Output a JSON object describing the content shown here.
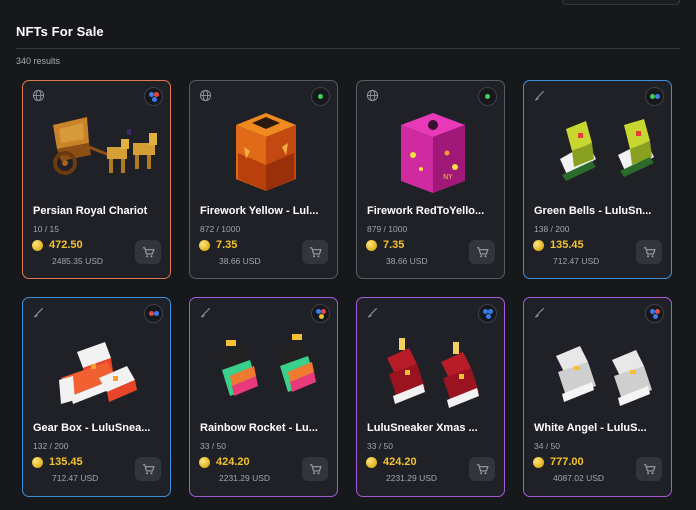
{
  "section": {
    "title": "NFTs For Sale",
    "results": "340 results"
  },
  "cards": [
    {
      "name": "Persian Royal Chariot",
      "supply": "10 / 15",
      "price": "472.50",
      "usd": "2485.35 USD",
      "type_icon": "globe-icon",
      "rarity": "three-dot-mixed",
      "border": "#e07a4e"
    },
    {
      "name": "Firework Yellow - Lul...",
      "supply": "872 / 1000",
      "price": "7.35",
      "usd": "38.66 USD",
      "type_icon": "globe-icon",
      "rarity": "single-green-dot",
      "border": "#5a5c64"
    },
    {
      "name": "Firework RedToYello...",
      "supply": "879 / 1000",
      "price": "7.35",
      "usd": "38.66 USD",
      "type_icon": "globe-icon",
      "rarity": "single-green-dot",
      "border": "#5a5c64"
    },
    {
      "name": "Green Bells - LuluSn...",
      "supply": "138 / 200",
      "price": "135.45",
      "usd": "712.47 USD",
      "type_icon": "brush-icon",
      "rarity": "two-blue-dots",
      "border": "#3f8fd8"
    },
    {
      "name": "Gear Box - LuluSnea...",
      "supply": "132 / 200",
      "price": "135.45",
      "usd": "712.47 USD",
      "type_icon": "brush-icon",
      "rarity": "two-red-blue-dots",
      "border": "#3f8fd8"
    },
    {
      "name": "Rainbow Rocket - Lu...",
      "supply": "33 / 50",
      "price": "424.20",
      "usd": "2231.29 USD",
      "type_icon": "brush-icon",
      "rarity": "three-dot-mixed",
      "border": "#a55bd6"
    },
    {
      "name": "LuluSneaker Xmas ...",
      "supply": "33 / 50",
      "price": "424.20",
      "usd": "2231.29 USD",
      "type_icon": "brush-icon",
      "rarity": "three-blue-dots",
      "border": "#a55bd6"
    },
    {
      "name": "White Angel - LuluS...",
      "supply": "34 / 50",
      "price": "777.00",
      "usd": "4087.02 USD",
      "type_icon": "brush-icon",
      "rarity": "three-dot-mixed",
      "border": "#a55bd6"
    }
  ],
  "colors": {
    "background": "#17181c",
    "card": "#202126",
    "price": "#f2c230"
  }
}
